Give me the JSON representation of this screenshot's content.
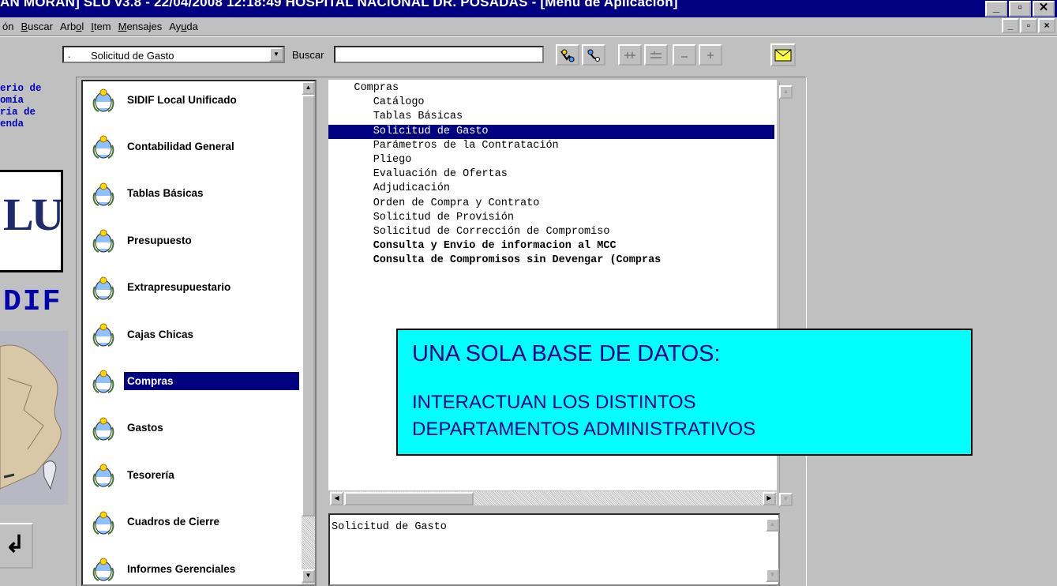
{
  "window": {
    "title": "AN MORAN]  SLU v3.8 - 22/04/2008 12:18:49 HOSPITAL NACIONAL DR. POSADAS - [Menú de Aplicación]",
    "controls": [
      "_",
      "▫",
      "✕"
    ],
    "mdi_controls": [
      "_",
      "▫",
      "×"
    ]
  },
  "menu": {
    "items": [
      {
        "pre": "ón",
        "u": "",
        "post": ""
      },
      {
        "pre": "",
        "u": "B",
        "post": "uscar"
      },
      {
        "pre": "Arb",
        "u": "o",
        "post": "l"
      },
      {
        "pre": "",
        "u": "I",
        "post": "tem"
      },
      {
        "pre": "",
        "u": "M",
        "post": "ensajes"
      },
      {
        "pre": "Ay",
        "u": "u",
        "post": "da"
      }
    ]
  },
  "toolbar": {
    "combo_prefix": ".",
    "combo_value": "Solicitud de Gasto",
    "search_label": "Buscar",
    "search_value": ""
  },
  "logo": {
    "text_lines": "erio de\nomía\nría de\nenda",
    "mark": "LU",
    "sidif": "DIF",
    "calc_glyph": "↲"
  },
  "modules": [
    {
      "label": "SIDIF Local Unificado",
      "selected": false
    },
    {
      "label": "Contabilidad General",
      "selected": false
    },
    {
      "label": "Tablas Básicas",
      "selected": false
    },
    {
      "label": "Presupuesto",
      "selected": false
    },
    {
      "label": "Extrapresupuestario",
      "selected": false
    },
    {
      "label": "Cajas Chicas",
      "selected": false
    },
    {
      "label": "Compras",
      "selected": true
    },
    {
      "label": "Gastos",
      "selected": false
    },
    {
      "label": "Tesorería",
      "selected": false
    },
    {
      "label": "Cuadros de Cierre",
      "selected": false
    },
    {
      "label": "Informes Gerenciales",
      "selected": false
    }
  ],
  "tree": [
    {
      "text": "    Compras",
      "bold": false,
      "selected": false
    },
    {
      "text": "       Catálogo",
      "bold": false,
      "selected": false
    },
    {
      "text": "       Tablas Básicas",
      "bold": false,
      "selected": false
    },
    {
      "text": "       Solicitud de Gasto",
      "bold": false,
      "selected": true
    },
    {
      "text": "       Parámetros de la Contratación",
      "bold": false,
      "selected": false
    },
    {
      "text": "       Pliego",
      "bold": false,
      "selected": false
    },
    {
      "text": "       Evaluación de Ofertas",
      "bold": false,
      "selected": false
    },
    {
      "text": "       Adjudicación",
      "bold": false,
      "selected": false
    },
    {
      "text": "       Orden de Compra y Contrato",
      "bold": false,
      "selected": false
    },
    {
      "text": "       Solicitud de Provisión",
      "bold": false,
      "selected": false
    },
    {
      "text": "       Solicitud de Corrección de Compromiso",
      "bold": false,
      "selected": false
    },
    {
      "text": "       Consulta y Envio de informacion al MCC",
      "bold": true,
      "selected": false
    },
    {
      "text": "       Consulta de Compromisos sin Devengar (Compras",
      "bold": true,
      "selected": false
    }
  ],
  "description": "Solicitud de Gasto",
  "callout": {
    "heading": "UNA SOLA BASE DE DATOS:",
    "line1": "INTERACTUAN LOS DISTINTOS",
    "line2": "DEPARTAMENTOS ADMINISTRATIVOS"
  },
  "colors": {
    "title_bg": "#000080",
    "selection": "#000080",
    "callout_bg": "#00ffff",
    "callout_text": "#00008b",
    "logo_text": "#0000c0"
  },
  "icons": {
    "toolbar": [
      "find-icon",
      "find-next-icon",
      "expand-all-icon",
      "collapse-all-icon",
      "collapse-icon",
      "expand-icon",
      "mail-icon"
    ],
    "module": "argentina-coat-of-arms-icon"
  }
}
